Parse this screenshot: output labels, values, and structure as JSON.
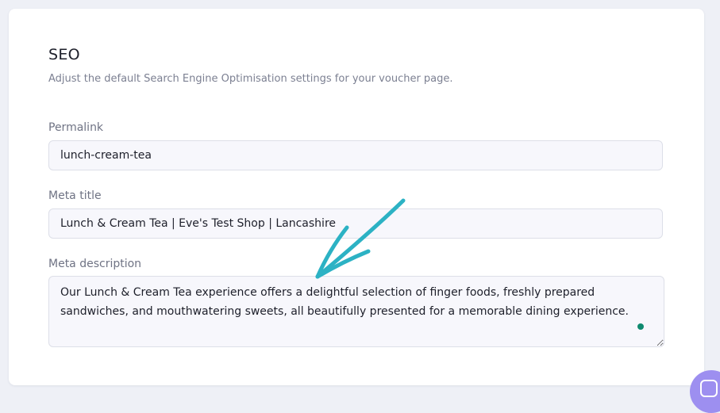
{
  "seo": {
    "title": "SEO",
    "subtitle": "Adjust the default Search Engine Optimisation settings for your voucher page.",
    "permalink": {
      "label": "Permalink",
      "value": "lunch-cream-tea"
    },
    "meta_title": {
      "label": "Meta title",
      "value": "Lunch & Cream Tea | Eve's Test Shop | Lancashire"
    },
    "meta_description": {
      "label": "Meta description",
      "value": "Our Lunch & Cream Tea experience offers a delightful selection of finger foods, freshly prepared sandwiches, and mouthwatering sweets, all beautifully presented for a memorable dining experience."
    }
  },
  "annotation": {
    "icon": "arrow-annotation-icon",
    "color": "#2cb2c4"
  },
  "chat": {
    "icon": "chat-icon",
    "color": "#9d8ff0"
  }
}
